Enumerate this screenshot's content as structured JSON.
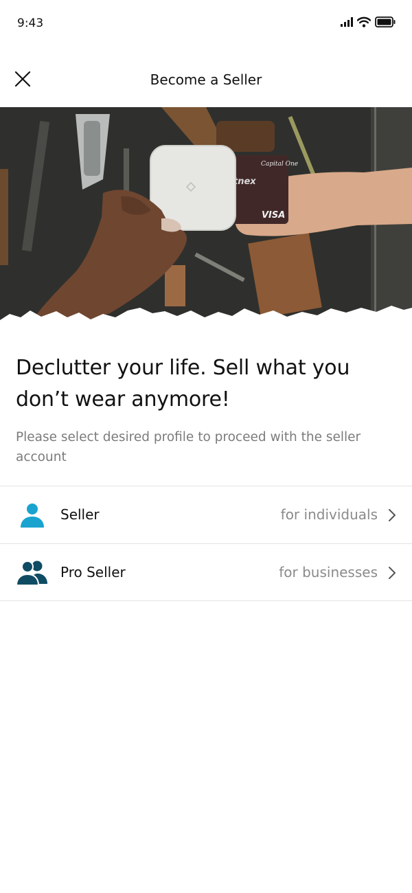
{
  "status_bar": {
    "time": "9:43",
    "icons": [
      "cellular-signal-icon",
      "wifi-icon",
      "battery-icon"
    ]
  },
  "nav": {
    "title": "Become a Seller",
    "close_icon": "close-icon"
  },
  "hero": {
    "card_brand": "VISA",
    "card_issuer": "Capital One"
  },
  "content": {
    "headline": "Declutter your life. Sell what you don’t wear anymore!",
    "subtext": "Please select desired profile to proceed with the seller account"
  },
  "options": [
    {
      "label": "Seller",
      "sub": "for individuals",
      "icon": "person-icon",
      "icon_color": "#1aa3cf"
    },
    {
      "label": "Pro Seller",
      "sub": "for businesses",
      "icon": "group-icon",
      "icon_color": "#0f4c63"
    }
  ],
  "colors": {
    "seller_icon": "#1aa3cf",
    "pro_seller_icon": "#0f4c63",
    "subtext": "#7b7b7b",
    "divider": "#e3e3e3"
  }
}
